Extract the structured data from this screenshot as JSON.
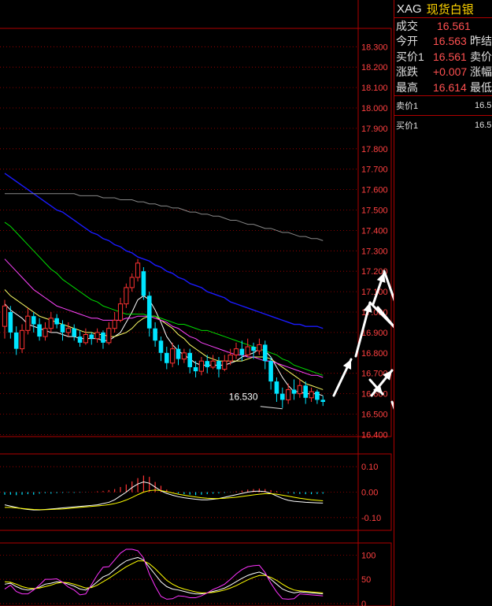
{
  "header": {
    "symbol": "XAG",
    "name": "现货白银"
  },
  "quote": {
    "rows": [
      {
        "label": "成交",
        "value": "16.561",
        "extra": ""
      },
      {
        "label": "今开",
        "value": "16.563",
        "extra": "昨结"
      },
      {
        "label": "买价1",
        "value": "16.561",
        "extra": "卖价"
      },
      {
        "label": "涨跌",
        "value": "+0.007",
        "extra": "涨幅"
      },
      {
        "label": "最高",
        "value": "16.614",
        "extra": "最低"
      }
    ],
    "ask_label": "卖价1",
    "ask_value": "16.5",
    "bid_label": "买价1",
    "bid_value": "16.5"
  },
  "colors": {
    "up": "#ff3232",
    "down": "#00e5ff",
    "grid": "#b00000",
    "label": "#ff4040"
  },
  "chart_data": [
    {
      "type": "candlestick",
      "ylim": [
        16.39,
        18.39
      ],
      "y_ticks": [
        "18.300",
        "18.200",
        "18.100",
        "18.000",
        "17.900",
        "17.800",
        "17.700",
        "17.600",
        "17.500",
        "17.400",
        "17.300",
        "17.200",
        "17.100",
        "17.000",
        "16.900",
        "16.800",
        "16.700",
        "16.600",
        "16.500",
        "16.400"
      ],
      "annotation": {
        "text": "16.530",
        "value": 16.53
      },
      "candles": [
        [
          16.93,
          17.03,
          16.87,
          17.06
        ],
        [
          17.0,
          16.9,
          16.87,
          17.03
        ],
        [
          16.9,
          16.82,
          16.79,
          16.93
        ],
        [
          16.82,
          16.91,
          16.8,
          16.94
        ],
        [
          16.91,
          16.98,
          16.89,
          17.02
        ],
        [
          16.98,
          16.94,
          16.9,
          17.0
        ],
        [
          16.94,
          16.88,
          16.86,
          16.97
        ],
        [
          16.88,
          16.92,
          16.86,
          16.95
        ],
        [
          16.92,
          16.97,
          16.9,
          17.0
        ],
        [
          16.97,
          16.94,
          16.92,
          16.99
        ],
        [
          16.94,
          16.9,
          16.86,
          16.96
        ],
        [
          16.9,
          16.92,
          16.88,
          16.95
        ],
        [
          16.92,
          16.88,
          16.86,
          16.94
        ],
        [
          16.88,
          16.85,
          16.83,
          16.91
        ],
        [
          16.85,
          16.89,
          16.84,
          16.92
        ],
        [
          16.89,
          16.87,
          16.84,
          16.9
        ],
        [
          16.87,
          16.9,
          16.85,
          16.92
        ],
        [
          16.9,
          16.85,
          16.82,
          16.91
        ],
        [
          16.85,
          16.92,
          16.84,
          16.95
        ],
        [
          16.92,
          16.96,
          16.9,
          17.0
        ],
        [
          16.96,
          17.04,
          16.95,
          17.07
        ],
        [
          17.04,
          17.12,
          17.02,
          17.14
        ],
        [
          17.12,
          17.17,
          17.1,
          17.19
        ],
        [
          17.17,
          17.24,
          17.15,
          17.26
        ],
        [
          17.2,
          17.08,
          17.06,
          17.22
        ],
        [
          17.08,
          16.92,
          16.88,
          17.1
        ],
        [
          16.92,
          16.86,
          16.83,
          16.95
        ],
        [
          16.86,
          16.8,
          16.76,
          16.88
        ],
        [
          16.8,
          16.75,
          16.72,
          16.83
        ],
        [
          16.75,
          16.82,
          16.73,
          16.85
        ],
        [
          16.82,
          16.77,
          16.74,
          16.84
        ],
        [
          16.77,
          16.8,
          16.75,
          16.82
        ],
        [
          16.8,
          16.73,
          16.7,
          16.82
        ],
        [
          16.73,
          16.71,
          16.68,
          16.76
        ],
        [
          16.71,
          16.76,
          16.69,
          16.78
        ],
        [
          16.76,
          16.73,
          16.7,
          16.79
        ],
        [
          16.73,
          16.76,
          16.72,
          16.79
        ],
        [
          16.76,
          16.72,
          16.68,
          16.78
        ],
        [
          16.72,
          16.76,
          16.71,
          16.79
        ],
        [
          16.76,
          16.79,
          16.74,
          16.82
        ],
        [
          16.79,
          16.82,
          16.77,
          16.85
        ],
        [
          16.82,
          16.79,
          16.76,
          16.86
        ],
        [
          16.79,
          16.83,
          16.78,
          16.87
        ],
        [
          16.83,
          16.81,
          16.77,
          16.85
        ],
        [
          16.81,
          16.84,
          16.79,
          16.87
        ],
        [
          16.84,
          16.76,
          16.72,
          16.86
        ],
        [
          16.76,
          16.66,
          16.62,
          16.78
        ],
        [
          16.66,
          16.6,
          16.56,
          16.68
        ],
        [
          16.6,
          16.57,
          16.53,
          16.63
        ],
        [
          16.57,
          16.62,
          16.55,
          16.65
        ],
        [
          16.62,
          16.6,
          16.57,
          16.67
        ],
        [
          16.6,
          16.64,
          16.58,
          16.67
        ],
        [
          16.64,
          16.58,
          16.55,
          16.66
        ],
        [
          16.58,
          16.61,
          16.56,
          16.63
        ],
        [
          16.61,
          16.57,
          16.55,
          16.62
        ],
        [
          16.57,
          16.56,
          16.54,
          16.59
        ]
      ],
      "ma": [
        {
          "values": [
            17.04,
            17.01,
            16.99,
            16.97,
            16.94,
            16.93,
            16.92,
            16.91,
            16.9,
            16.9,
            16.89,
            16.88,
            16.88,
            16.87,
            16.87,
            16.87,
            16.87,
            16.86,
            16.86,
            16.88,
            16.9,
            16.95,
            17.0,
            17.06,
            17.08,
            17.06,
            17.01,
            16.95,
            16.88,
            16.84,
            16.81,
            16.79,
            16.77,
            16.75,
            16.74,
            16.74,
            16.74,
            16.74,
            16.74,
            16.75,
            16.76,
            16.78,
            16.79,
            16.8,
            16.82,
            16.81,
            16.78,
            16.73,
            16.68,
            16.64,
            16.61,
            16.61,
            16.6,
            16.6,
            16.6,
            16.59
          ],
          "color": "#ffffff",
          "width": 1
        },
        {
          "values": [
            17.11,
            17.08,
            17.06,
            17.04,
            17.02,
            17.0,
            16.98,
            16.97,
            16.96,
            16.95,
            16.94,
            16.93,
            16.92,
            16.91,
            16.9,
            16.9,
            16.89,
            16.89,
            16.88,
            16.88,
            16.89,
            16.9,
            16.92,
            16.95,
            16.97,
            16.98,
            16.98,
            16.96,
            16.94,
            16.92,
            16.89,
            16.87,
            16.84,
            16.82,
            16.8,
            16.78,
            16.77,
            16.76,
            16.76,
            16.76,
            16.76,
            16.76,
            16.77,
            16.78,
            16.78,
            16.78,
            16.77,
            16.75,
            16.73,
            16.71,
            16.69,
            16.67,
            16.65,
            16.64,
            16.63,
            16.62
          ],
          "color": "#ffff66",
          "width": 1
        },
        {
          "values": [
            17.26,
            17.23,
            17.2,
            17.17,
            17.14,
            17.11,
            17.09,
            17.07,
            17.05,
            17.03,
            17.02,
            17.01,
            17.0,
            16.99,
            16.98,
            16.97,
            16.97,
            16.96,
            16.96,
            16.96,
            16.96,
            16.97,
            16.97,
            16.98,
            16.98,
            16.98,
            16.97,
            16.96,
            16.95,
            16.93,
            16.92,
            16.9,
            16.88,
            16.87,
            16.85,
            16.84,
            16.83,
            16.82,
            16.81,
            16.8,
            16.79,
            16.79,
            16.78,
            16.78,
            16.77,
            16.76,
            16.76,
            16.75,
            16.74,
            16.73,
            16.72,
            16.71,
            16.7,
            16.69,
            16.69,
            16.68
          ],
          "color": "#ff44ff",
          "width": 1
        },
        {
          "values": [
            17.44,
            17.42,
            17.39,
            17.36,
            17.33,
            17.3,
            17.27,
            17.24,
            17.21,
            17.19,
            17.16,
            17.14,
            17.12,
            17.1,
            17.08,
            17.06,
            17.05,
            17.03,
            17.02,
            17.01,
            17.0,
            16.99,
            16.99,
            16.99,
            16.99,
            16.98,
            16.98,
            16.97,
            16.96,
            16.95,
            16.94,
            16.94,
            16.93,
            16.92,
            16.91,
            16.91,
            16.9,
            16.89,
            16.88,
            16.87,
            16.86,
            16.85,
            16.84,
            16.83,
            16.82,
            16.81,
            16.8,
            16.79,
            16.77,
            16.76,
            16.74,
            16.73,
            16.72,
            16.71,
            16.7,
            16.69
          ],
          "color": "#00dd00",
          "width": 1
        },
        {
          "values": [
            17.68,
            17.66,
            17.64,
            17.62,
            17.6,
            17.58,
            17.56,
            17.54,
            17.52,
            17.5,
            17.49,
            17.47,
            17.45,
            17.43,
            17.41,
            17.39,
            17.38,
            17.36,
            17.35,
            17.33,
            17.32,
            17.3,
            17.29,
            17.27,
            17.26,
            17.25,
            17.23,
            17.22,
            17.2,
            17.19,
            17.17,
            17.16,
            17.14,
            17.13,
            17.12,
            17.1,
            17.09,
            17.08,
            17.07,
            17.05,
            17.04,
            17.03,
            17.02,
            17.01,
            17.0,
            16.99,
            16.98,
            16.97,
            16.96,
            16.95,
            16.94,
            16.94,
            16.93,
            16.93,
            16.93,
            16.92
          ],
          "color": "#1a1aff",
          "width": 1.4
        },
        {
          "values": [
            17.58,
            17.58,
            17.58,
            17.58,
            17.58,
            17.58,
            17.58,
            17.58,
            17.58,
            17.58,
            17.58,
            17.58,
            17.58,
            17.57,
            17.57,
            17.57,
            17.57,
            17.56,
            17.56,
            17.56,
            17.55,
            17.55,
            17.55,
            17.54,
            17.54,
            17.53,
            17.53,
            17.52,
            17.52,
            17.51,
            17.51,
            17.5,
            17.49,
            17.49,
            17.48,
            17.48,
            17.47,
            17.47,
            17.46,
            17.45,
            17.45,
            17.44,
            17.43,
            17.43,
            17.42,
            17.41,
            17.41,
            17.4,
            17.39,
            17.39,
            17.38,
            17.37,
            17.37,
            17.36,
            17.36,
            17.35
          ],
          "color": "#888888",
          "width": 1
        }
      ]
    },
    {
      "type": "macd",
      "ylim": [
        -0.15,
        0.15
      ],
      "y_ticks": [
        "0.10",
        "0.00",
        "-0.10"
      ],
      "hist": [
        -0.01,
        -0.01,
        -0.012,
        -0.01,
        -0.008,
        -0.01,
        -0.006,
        -0.004,
        -0.006,
        -0.004,
        -0.003,
        -0.002,
        -0.003,
        -0.002,
        -0.001,
        0.0,
        0.003,
        0.005,
        0.008,
        0.012,
        0.02,
        0.03,
        0.042,
        0.055,
        0.065,
        0.06,
        0.04,
        0.025,
        0.01,
        0.0,
        -0.005,
        -0.008,
        -0.01,
        -0.012,
        -0.01,
        -0.008,
        -0.006,
        -0.005,
        -0.003,
        -0.001,
        0.003,
        0.006,
        0.01,
        0.012,
        0.014,
        0.012,
        0.008,
        0.004,
        0.0,
        -0.004,
        -0.006,
        -0.007,
        -0.008,
        -0.008,
        -0.007,
        -0.006
      ],
      "lines": [
        {
          "values": [
            -0.05,
            -0.055,
            -0.06,
            -0.065,
            -0.068,
            -0.07,
            -0.07,
            -0.068,
            -0.066,
            -0.064,
            -0.062,
            -0.06,
            -0.058,
            -0.056,
            -0.054,
            -0.052,
            -0.05,
            -0.045,
            -0.04,
            -0.03,
            -0.015,
            0.0,
            0.018,
            0.032,
            0.04,
            0.035,
            0.02,
            0.005,
            -0.005,
            -0.012,
            -0.018,
            -0.022,
            -0.025,
            -0.028,
            -0.03,
            -0.03,
            -0.028,
            -0.025,
            -0.02,
            -0.015,
            -0.01,
            -0.005,
            0.0,
            0.003,
            0.004,
            0.002,
            -0.005,
            -0.015,
            -0.025,
            -0.032,
            -0.036,
            -0.038,
            -0.04,
            -0.041,
            -0.042,
            -0.043
          ],
          "color": "#ffffff"
        },
        {
          "values": [
            -0.06,
            -0.06,
            -0.062,
            -0.064,
            -0.066,
            -0.068,
            -0.069,
            -0.069,
            -0.068,
            -0.067,
            -0.066,
            -0.064,
            -0.062,
            -0.06,
            -0.058,
            -0.056,
            -0.054,
            -0.052,
            -0.049,
            -0.045,
            -0.039,
            -0.031,
            -0.021,
            -0.01,
            0.0,
            0.006,
            0.008,
            0.006,
            0.002,
            -0.003,
            -0.008,
            -0.012,
            -0.016,
            -0.019,
            -0.022,
            -0.024,
            -0.025,
            -0.025,
            -0.024,
            -0.022,
            -0.02,
            -0.017,
            -0.014,
            -0.011,
            -0.008,
            -0.006,
            -0.006,
            -0.008,
            -0.012,
            -0.016,
            -0.02,
            -0.024,
            -0.027,
            -0.03,
            -0.032,
            -0.034
          ],
          "color": "#ffff00"
        }
      ]
    },
    {
      "type": "kdj",
      "ylim": [
        -5,
        125
      ],
      "y_ticks": [
        "100",
        "50",
        "0"
      ],
      "lines": [
        {
          "values": [
            40,
            42,
            35,
            30,
            28,
            30,
            34,
            40,
            42,
            45,
            44,
            40,
            36,
            30,
            28,
            35,
            45,
            55,
            60,
            70,
            80,
            88,
            92,
            95,
            90,
            75,
            60,
            45,
            35,
            30,
            28,
            25,
            22,
            20,
            20,
            22,
            25,
            28,
            32,
            38,
            45,
            52,
            58,
            62,
            65,
            60,
            50,
            40,
            30,
            25,
            22,
            24,
            23,
            22,
            21,
            20
          ],
          "color": "#ffffff"
        },
        {
          "values": [
            45,
            44,
            40,
            35,
            32,
            31,
            32,
            35,
            38,
            42,
            44,
            43,
            40,
            36,
            32,
            33,
            38,
            45,
            52,
            60,
            68,
            76,
            82,
            88,
            88,
            82,
            72,
            60,
            48,
            40,
            34,
            30,
            27,
            24,
            22,
            22,
            23,
            25,
            28,
            32,
            37,
            43,
            49,
            54,
            58,
            58,
            54,
            48,
            40,
            33,
            28,
            26,
            25,
            24,
            23,
            22
          ],
          "color": "#ffff00"
        },
        {
          "values": [
            30,
            38,
            25,
            20,
            20,
            28,
            38,
            50,
            50,
            51,
            44,
            34,
            28,
            18,
            20,
            39,
            59,
            75,
            76,
            90,
            104,
            112,
            112,
            109,
            94,
            61,
            36,
            15,
            9,
            10,
            16,
            15,
            12,
            12,
            16,
            22,
            29,
            34,
            40,
            50,
            61,
            70,
            76,
            78,
            79,
            64,
            42,
            24,
            10,
            9,
            10,
            20,
            19,
            18,
            17,
            16
          ],
          "color": "#ff33ff"
        }
      ]
    }
  ]
}
